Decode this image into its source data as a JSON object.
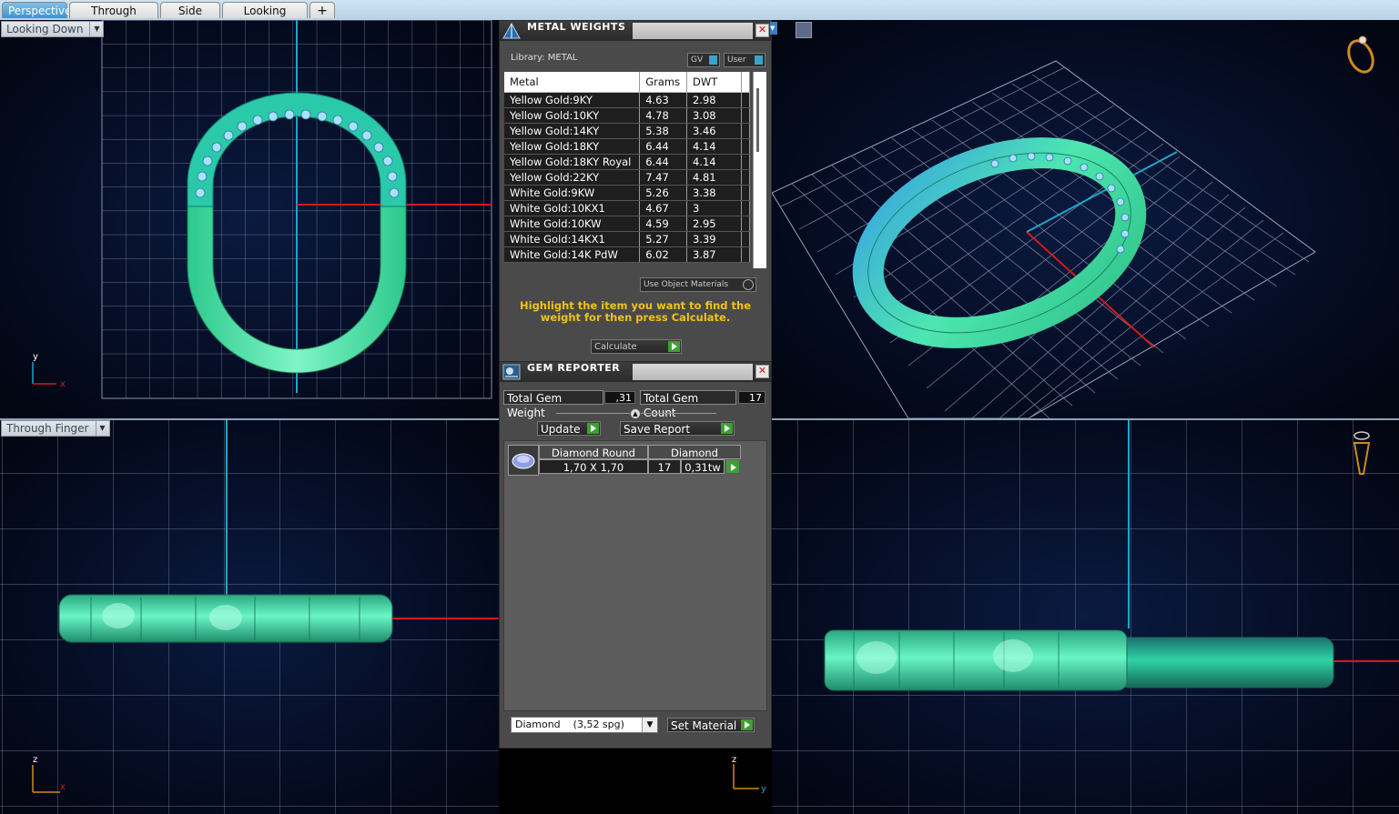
{
  "tabs": [
    {
      "label": "Perspective",
      "active": true
    },
    {
      "label": "Through Finger",
      "active": false
    },
    {
      "label": "Side View",
      "active": false
    },
    {
      "label": "Looking Down",
      "active": false
    }
  ],
  "add_tab_icon": "plus-icon",
  "viewports": {
    "top_left": {
      "label": "Looking Down",
      "axis_v": "y",
      "axis_h": "x"
    },
    "bottom_left": {
      "label": "Through Finger",
      "axis_v": "z",
      "axis_h": "x"
    },
    "bottom_right": {
      "axis_v": "z",
      "axis_h": "y"
    }
  },
  "metal_weights": {
    "title": "METAL WEIGHTS",
    "library_label": "Library: METAL",
    "gv_label": "GV",
    "user_label": "User",
    "columns": [
      "Metal",
      "Grams",
      "DWT"
    ],
    "rows": [
      [
        "Yellow Gold:9KY",
        "4.63",
        "2.98"
      ],
      [
        "Yellow Gold:10KY",
        "4.78",
        "3.08"
      ],
      [
        "Yellow Gold:14KY",
        "5.38",
        "3.46"
      ],
      [
        "Yellow Gold:18KY",
        "6.44",
        "4.14"
      ],
      [
        "Yellow Gold:18KY Royal",
        "6.44",
        "4.14"
      ],
      [
        "Yellow Gold:22KY",
        "7.47",
        "4.81"
      ],
      [
        "White Gold:9KW",
        "5.26",
        "3.38"
      ],
      [
        "White Gold:10KX1",
        "4.67",
        "3"
      ],
      [
        "White Gold:10KW",
        "4.59",
        "2.95"
      ],
      [
        "White Gold:14KX1",
        "5.27",
        "3.39"
      ],
      [
        "White Gold:14K PdW",
        "6.02",
        "3.87"
      ]
    ],
    "use_object_materials": "Use Object Materials",
    "instruction": "Highlight the item you want to find the weight for then press Calculate.",
    "calculate_label": "Calculate"
  },
  "gem_reporter": {
    "title": "GEM REPORTER",
    "total_gem_weight_label": "Total Gem Weight",
    "total_gem_weight": ",31",
    "total_gem_count_label": "Total Gem Count",
    "total_gem_count": "17",
    "update_label": "Update",
    "save_report_label": "Save Report",
    "gem": {
      "shape": "Diamond Round",
      "material": "Diamond",
      "size": "1,70 X 1,70",
      "count": "17",
      "weight": "0,31tw"
    },
    "material_select": "Diamond    (3,52 spg)",
    "set_material_label": "Set Material"
  },
  "colors": {
    "ring": "#3fe3a0",
    "ring_blue": "#3aa6e0",
    "grid": "#9aa3b8",
    "axis_cyan": "#1fa6c8",
    "axis_red": "#d21a1a",
    "panel_bg": "#4a4a4a",
    "highlight_text": "#f2c21b"
  }
}
